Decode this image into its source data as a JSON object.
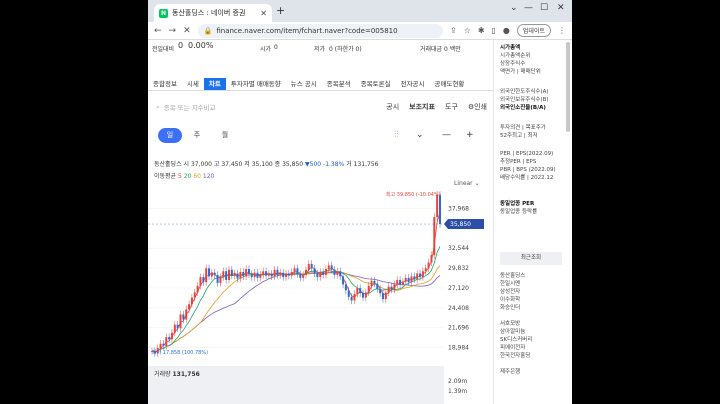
{
  "browser": {
    "tab_title": "동산홀딩스 : 네이버 증권",
    "url": "finance.naver.com/item/fchart.naver?code=005810",
    "update_label": "업데이트"
  },
  "quote": {
    "prev_close_label": "전일대비",
    "change": "0",
    "change_pct": "0.00%",
    "open_label": "시가",
    "open_value": "0",
    "low_label": "저가",
    "low_value": "0 (하한가 0)",
    "amount_label": "거래대금",
    "amount_value": "0 백만"
  },
  "subnav": [
    "종합정보",
    "시세",
    "차트",
    "투자자별 매매동향",
    "뉴스 공시",
    "종목분석",
    "종목토론실",
    "전자공시",
    "공매도현황"
  ],
  "search": {
    "placeholder": "종목 또는 지수비교"
  },
  "tools": {
    "notice": "공시",
    "indicator": "보조지표",
    "tool": "도구",
    "print": "인쇄"
  },
  "periods": [
    "일",
    "주",
    "월"
  ],
  "ohlc": {
    "name": "동산홀딩스",
    "open_label": "시",
    "open": "37,000",
    "high_label": "고",
    "high": "37,450",
    "low_label": "저",
    "low": "35,100",
    "close_label": "종",
    "close": "35,850",
    "change": "▼500",
    "change_pct": "-1.38%",
    "vol_label": "거",
    "vol": "131,756"
  },
  "ma": {
    "label": "이동평균",
    "p5": "5",
    "p20": "20",
    "p60": "60",
    "p120": "120"
  },
  "scale_label": "Linear",
  "chart_data": {
    "type": "line",
    "title": "",
    "y_ticks": [
      37968,
      35850,
      32544,
      29832,
      27120,
      24408,
      21696,
      18984
    ],
    "current_price": 35850,
    "max_label": "최고 39,850 (-10.04%)",
    "min_label": "최저 17,858 (100.78%)",
    "ylim": [
      17000,
      40500
    ],
    "series": [
      {
        "name": "5",
        "color": "#e7453b"
      },
      {
        "name": "20",
        "color": "#1ea86a"
      },
      {
        "name": "60",
        "color": "#e0a11c"
      },
      {
        "name": "120",
        "color": "#7b5cc4"
      }
    ],
    "candles": [
      18500,
      18200,
      18900,
      19500,
      19200,
      20400,
      20100,
      21000,
      22100,
      21600,
      23500,
      22800,
      24200,
      24900,
      25800,
      26500,
      27400,
      28600,
      27900,
      29800,
      28700,
      29200,
      28900,
      27800,
      28600,
      29400,
      28200,
      29600,
      28800,
      29100,
      28400,
      29300,
      28700,
      29700,
      29000,
      28600,
      29200,
      28500,
      28900,
      29400,
      28800,
      29100,
      28700,
      29600,
      28900,
      29200,
      28600,
      29100,
      28800,
      29300,
      29800,
      29000,
      28500,
      28900,
      29600,
      30400,
      29800,
      29100,
      28600,
      29300,
      28900,
      29700,
      30200,
      29600,
      28900,
      29400,
      28700,
      27600,
      26800,
      25900,
      25400,
      26300,
      27100,
      26400,
      25800,
      26500,
      27400,
      28100,
      27700,
      27000,
      26400,
      25600,
      26500,
      27300,
      26900,
      27600,
      28200,
      27600,
      28000,
      28500,
      27900,
      28700,
      28300,
      29100,
      28600,
      29400,
      29800,
      30600,
      31600,
      36800,
      39850,
      35850
    ],
    "volume_ticks": [
      "2.09m",
      "1.39m"
    ],
    "volume_label": "거래량",
    "volume_value": "131,756"
  },
  "right": {
    "market_cap": "시가총액",
    "market_cap_rank": "시가총액순위",
    "shares": "상장주식수",
    "face": "액면가 | 매매단위",
    "foreign1": "외국인한도주식수(A)",
    "foreign2": "외국인보유주식수(B)",
    "foreign3": "외국인소진율(B/A)",
    "opinion": "투자의견 | 목표주가",
    "high52": "52주최고 | 최저",
    "per": "PER | EPS(2022.09)",
    "est_per": "추정PER | EPS",
    "pbr": "PBR | BPS (2022.09)",
    "div": "배당수익률 | 2022.12",
    "sector_per": "동일업종 PER",
    "sector_change": "동일업종 등락률",
    "recent_header": "최근조회",
    "recent": [
      "동산홀딩스",
      "한일시멘",
      "삼성전자",
      "이수화학",
      "화승인더",
      "",
      "서호모방",
      "삼아알미늄",
      "SK디스커버리",
      "피에이전자",
      "한국전자홀딩",
      "",
      "제주은행"
    ]
  }
}
